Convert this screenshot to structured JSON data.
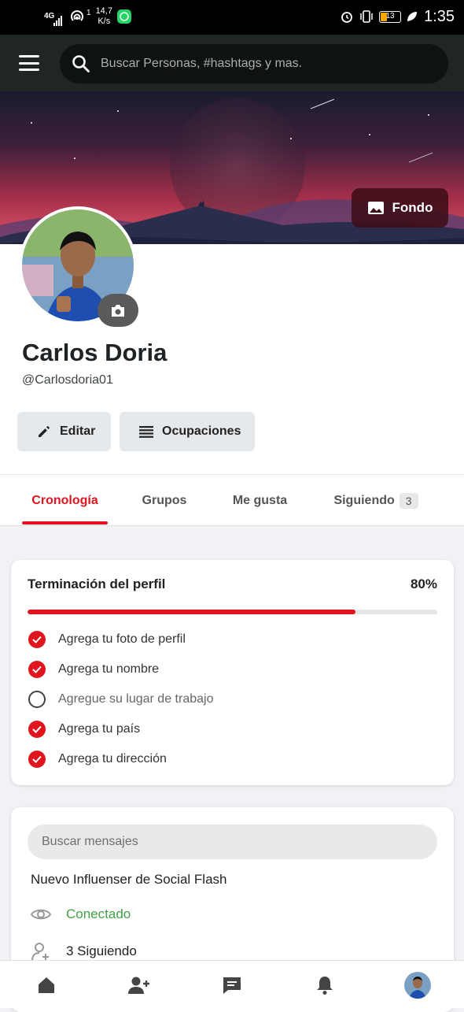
{
  "status_bar": {
    "network": "4G",
    "hotspot_count": "1",
    "speed_value": "14,7",
    "speed_unit": "K/s",
    "battery": "13",
    "time": "1:35"
  },
  "search": {
    "placeholder": "Buscar Personas, #hashtags y mas."
  },
  "cover": {
    "background_button": "Fondo"
  },
  "profile": {
    "name": "Carlos Doria",
    "handle": "@Carlosdoria01",
    "edit_label": "Editar",
    "occupations_label": "Ocupaciones"
  },
  "tabs": [
    {
      "label": "Cronología",
      "active": true
    },
    {
      "label": "Grupos"
    },
    {
      "label": "Me gusta"
    },
    {
      "label": "Siguiendo",
      "count": "3"
    }
  ],
  "completion": {
    "title": "Terminación del perfil",
    "percent_label": "80%",
    "progress": 0.8,
    "tasks": [
      {
        "label": "Agrega tu foto de perfil",
        "done": true
      },
      {
        "label": "Agrega tu nombre",
        "done": true
      },
      {
        "label": "Agregue su lugar de trabajo",
        "done": false
      },
      {
        "label": "Agrega tu país",
        "done": true
      },
      {
        "label": "Agrega tu dirección",
        "done": true
      }
    ]
  },
  "about": {
    "search_placeholder": "Buscar mensajes",
    "bio": "Nuevo Influenser de Social Flash",
    "status": "Conectado",
    "following": "3 Siguiendo"
  },
  "colors": {
    "accent": "#e0141e",
    "online": "#43a047",
    "topbar": "#202624"
  },
  "bottom_nav": [
    "home-icon",
    "add-user-icon",
    "messages-icon",
    "bell-icon",
    "profile-avatar"
  ]
}
